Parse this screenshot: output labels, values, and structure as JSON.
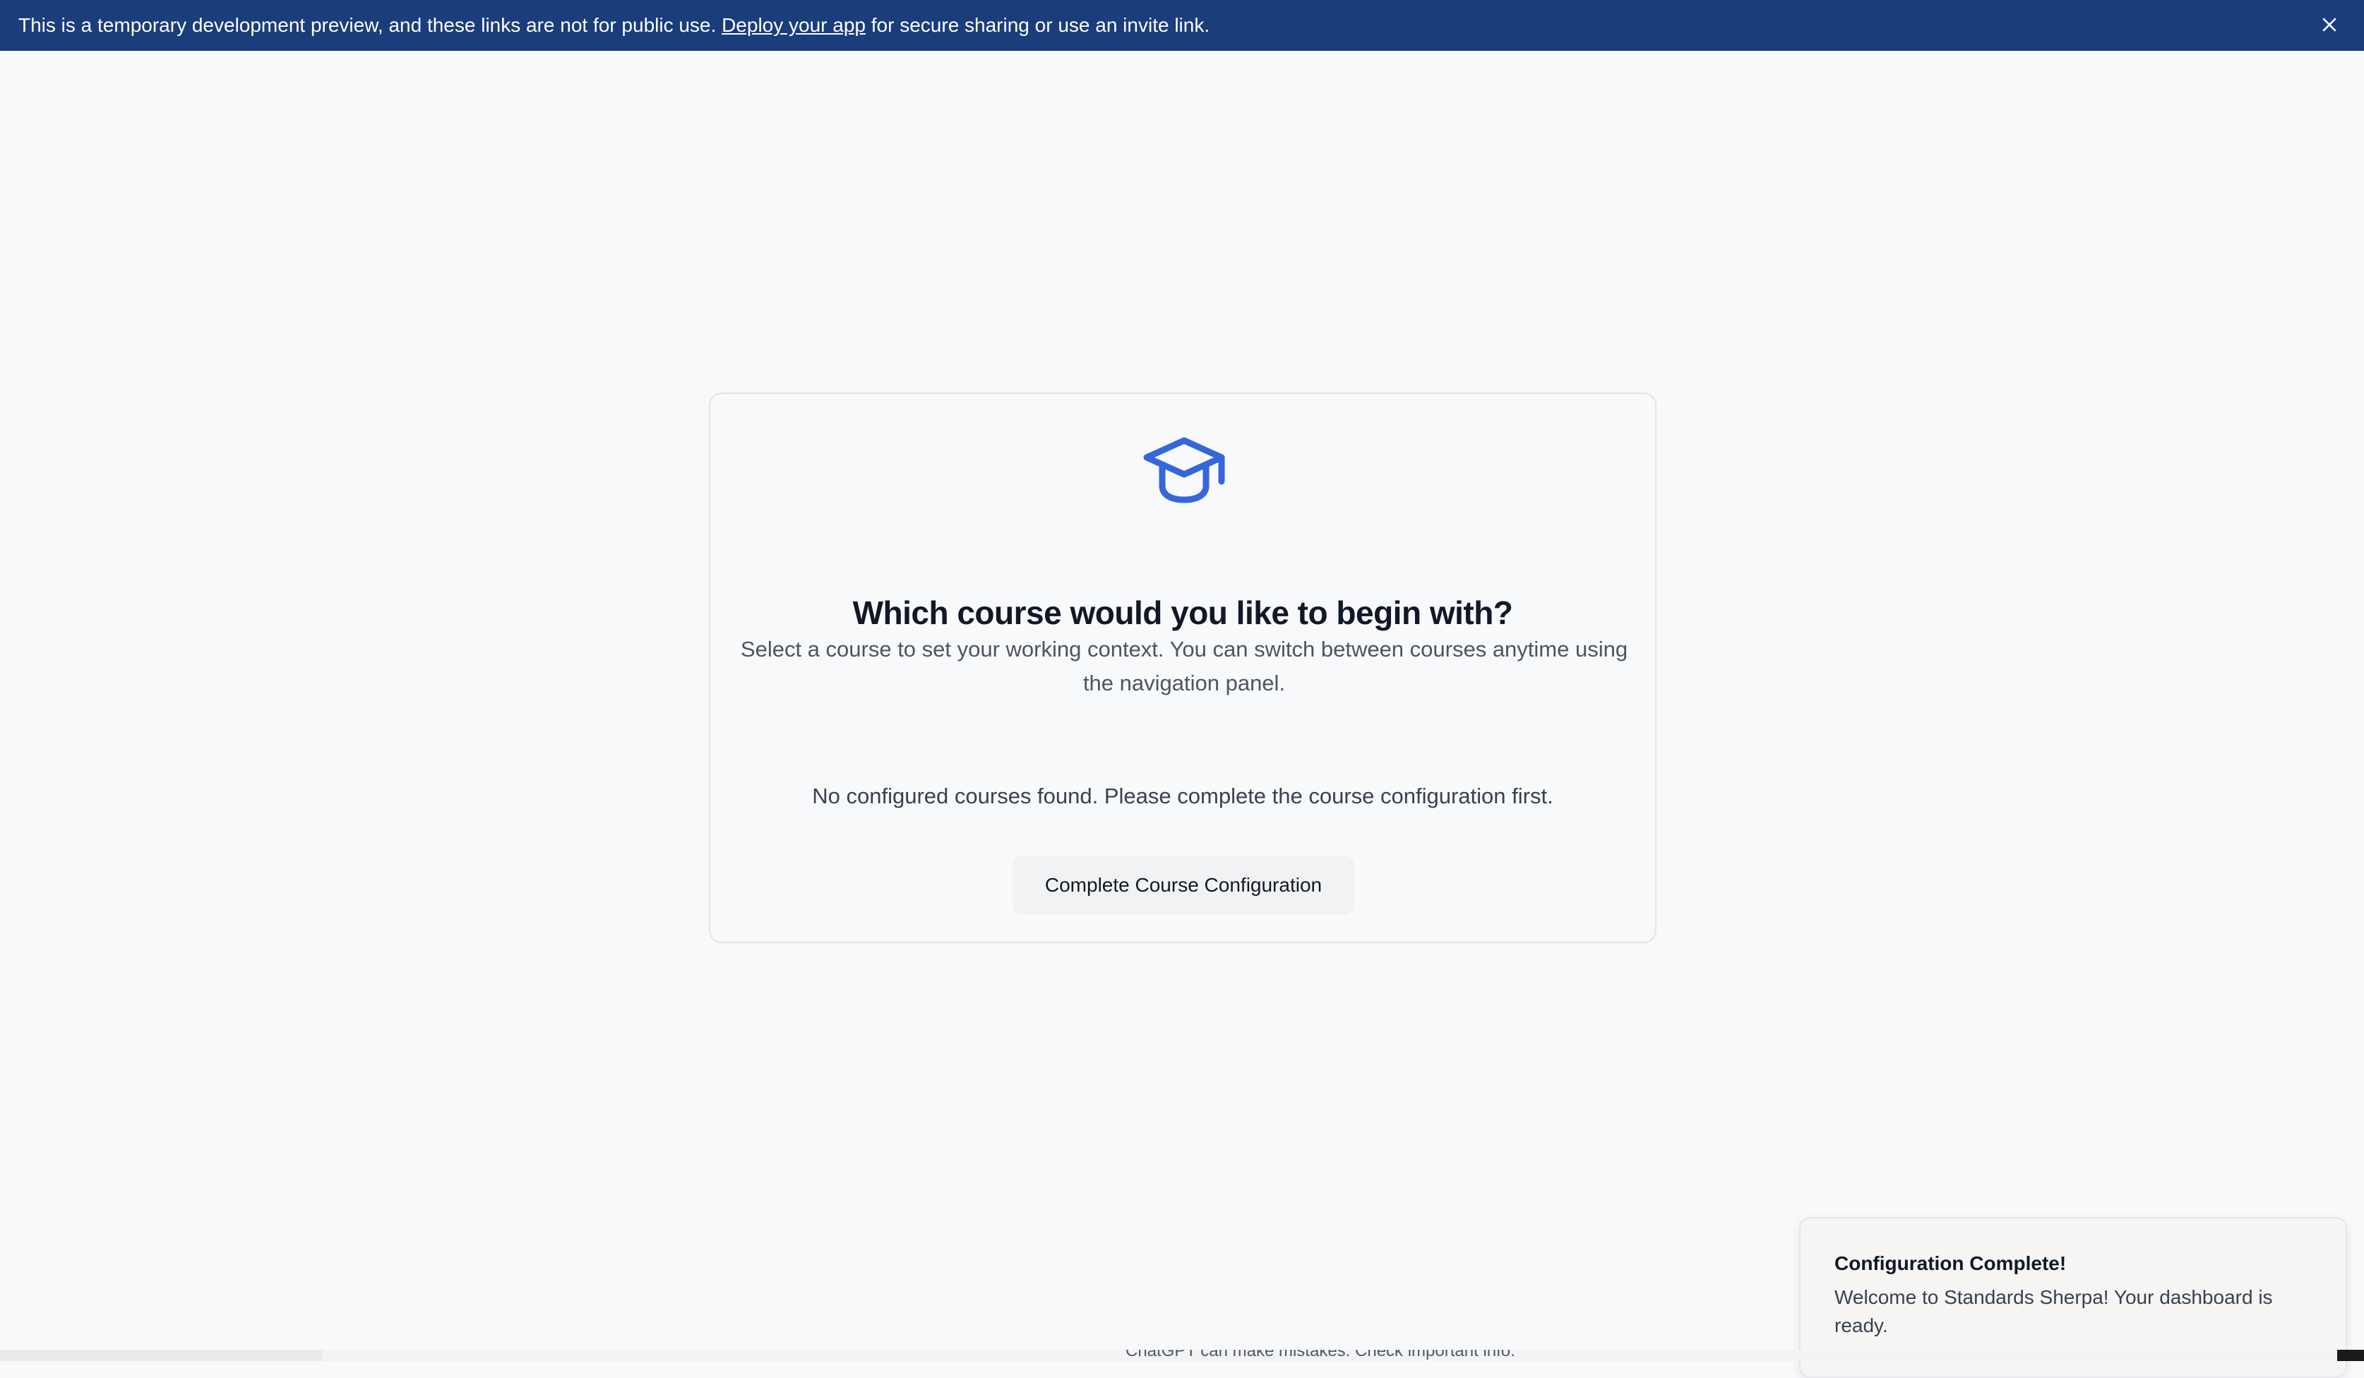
{
  "banner": {
    "message_before": "This is a temporary development preview, and these links are not for public use. ",
    "link_text": "Deploy your app",
    "message_after": " for secure sharing or use an invite link.",
    "close_icon": "close-icon",
    "background": "#1a3d7c"
  },
  "card": {
    "icon": "graduation-cap-icon",
    "icon_color": "#3566db",
    "title": "Which course would you like to begin with?",
    "subtitle": "Select a course to set your working context. You can switch between courses anytime using the navigation panel.",
    "empty_message": "No configured courses found. Please complete the course configuration first.",
    "button_label": "Complete Course Configuration"
  },
  "toast": {
    "title": "Configuration Complete!",
    "body": "Welcome to Standards Sherpa! Your dashboard is ready."
  },
  "underlying": {
    "disclaimer": "ChatGPT can make mistakes. Check important info."
  }
}
